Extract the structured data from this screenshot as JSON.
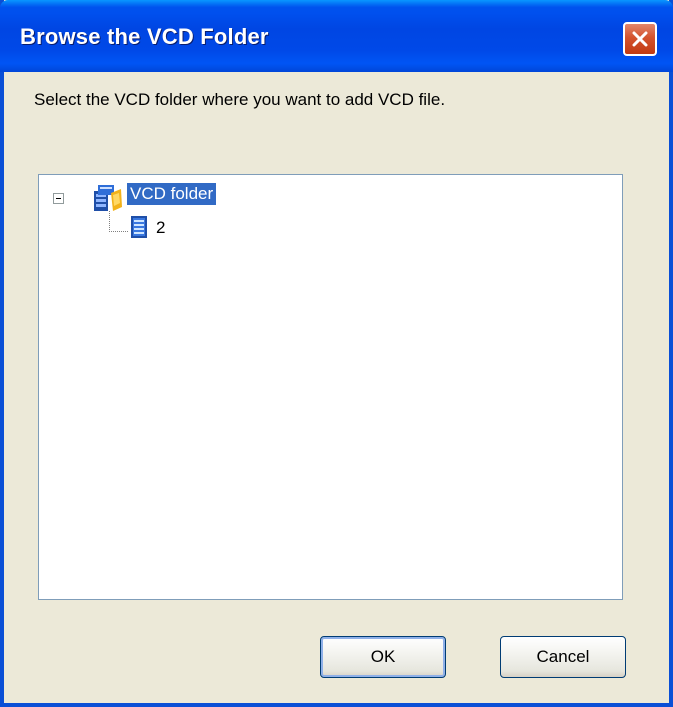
{
  "window": {
    "title": "Browse the VCD Folder",
    "close_icon": "close-icon"
  },
  "prompt": "Select the VCD folder where you want to add VCD file.",
  "tree": {
    "root": {
      "label": "VCD folder",
      "icon": "vcd-folder-icon",
      "expanded": true,
      "selected": true
    },
    "children": [
      {
        "label": "2",
        "icon": "disc-file-icon"
      }
    ]
  },
  "buttons": {
    "ok": "OK",
    "cancel": "Cancel"
  },
  "colors": {
    "titlebar": "#0053ee",
    "dialog_bg": "#ece9d8",
    "selection": "#316ac5",
    "close_button": "#d4532e"
  }
}
